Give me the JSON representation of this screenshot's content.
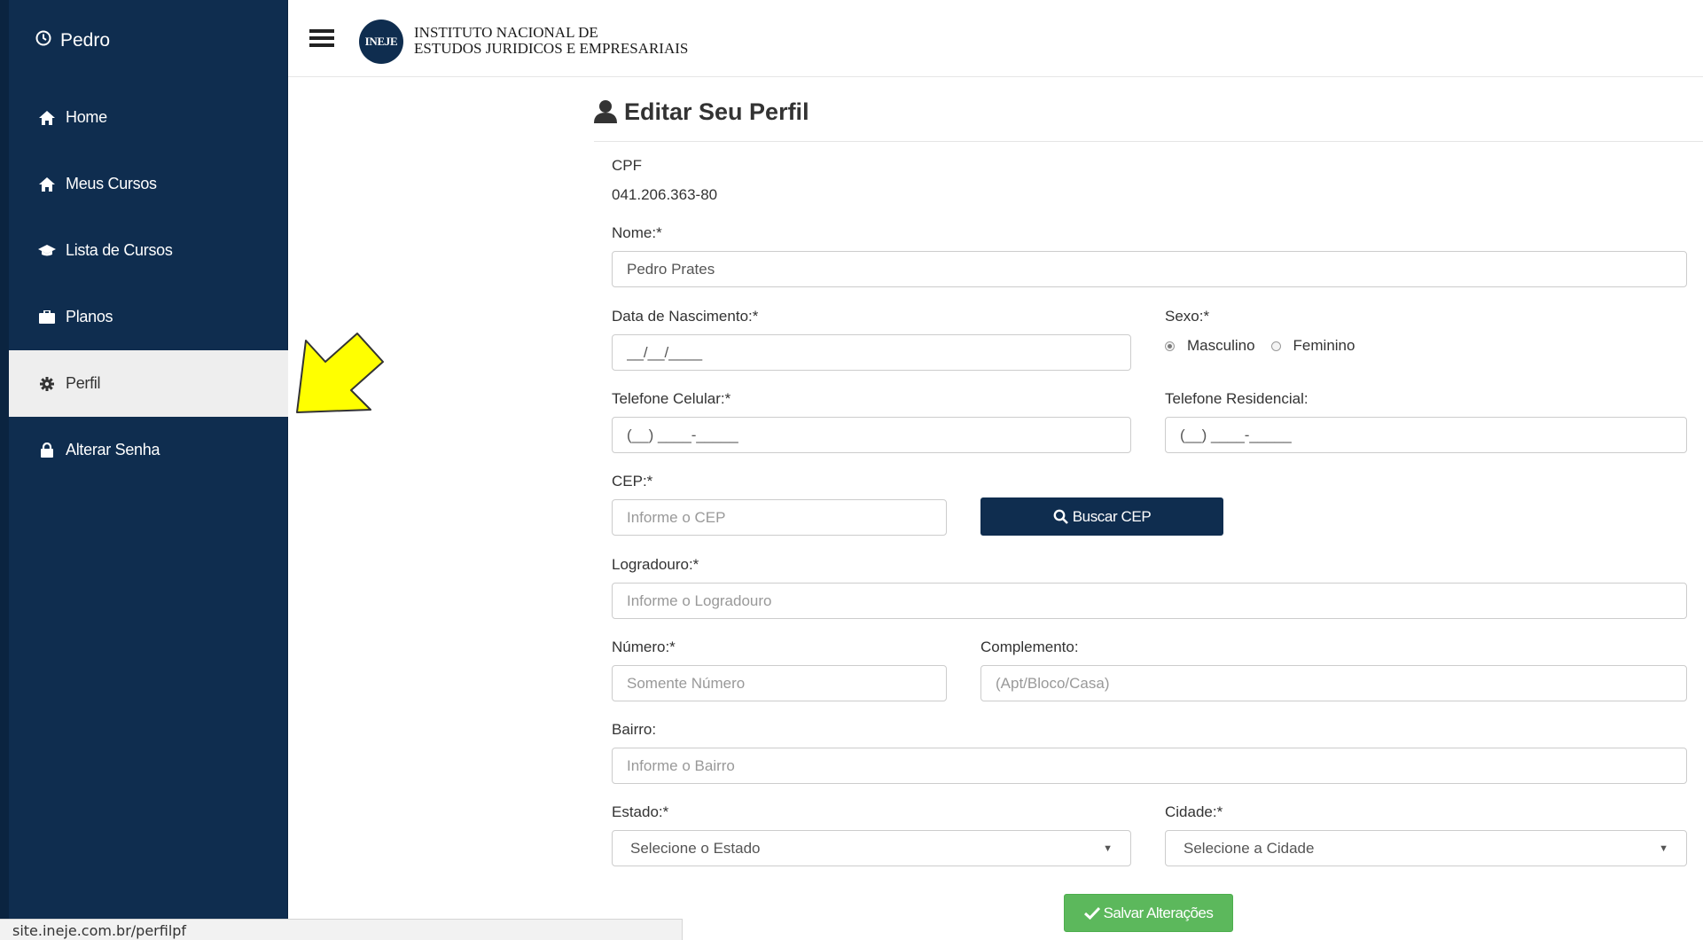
{
  "sidebar": {
    "user_name": "Pedro",
    "items": [
      {
        "label": "Home",
        "icon": "home-icon"
      },
      {
        "label": "Meus Cursos",
        "icon": "home-icon"
      },
      {
        "label": "Lista de Cursos",
        "icon": "graduation-cap-icon"
      },
      {
        "label": "Planos",
        "icon": "briefcase-icon"
      },
      {
        "label": "Perfil",
        "icon": "gear-icon",
        "active": true
      },
      {
        "label": "Alterar Senha",
        "icon": "lock-icon"
      }
    ]
  },
  "header": {
    "logo_text": "INEJE",
    "org_line1": "INSTITUTO NACIONAL DE",
    "org_line2": "ESTUDOS JURIDICOS E EMPRESARIAIS"
  },
  "form": {
    "title": "Editar Seu Perfil",
    "cpf_label": "CPF",
    "cpf_value": "041.206.363-80",
    "nome_label": "Nome:*",
    "nome_value": "Pedro Prates",
    "nascimento_label": "Data de Nascimento:*",
    "nascimento_value": "__/__/____",
    "sexo_label": "Sexo:*",
    "sexo_options": [
      "Masculino",
      "Feminino"
    ],
    "sexo_selected": "Masculino",
    "celular_label": "Telefone Celular:*",
    "celular_value": "(__) ____-_____",
    "residencial_label": "Telefone Residencial:",
    "residencial_value": "(__) ____-_____",
    "cep_label": "CEP:*",
    "cep_placeholder": "Informe o CEP",
    "buscar_cep_label": "Buscar CEP",
    "logradouro_label": "Logradouro:*",
    "logradouro_placeholder": "Informe o Logradouro",
    "numero_label": "Número:*",
    "numero_placeholder": "Somente Número",
    "complemento_label": "Complemento:",
    "complemento_placeholder": "(Apt/Bloco/Casa)",
    "bairro_label": "Bairro:",
    "bairro_placeholder": "Informe o Bairro",
    "estado_label": "Estado:*",
    "estado_value": "Selecione o Estado",
    "cidade_label": "Cidade:*",
    "cidade_value": "Selecione a Cidade",
    "save_label": "Salvar Alterações"
  },
  "colors": {
    "sidebar_bg": "#0f2d4f",
    "primary_button": "#0f2d4f",
    "success_button": "#5cb85c",
    "annotation_arrow": "#ffff00"
  },
  "statusbar": {
    "url": "site.ineje.com.br/perfilpf"
  }
}
